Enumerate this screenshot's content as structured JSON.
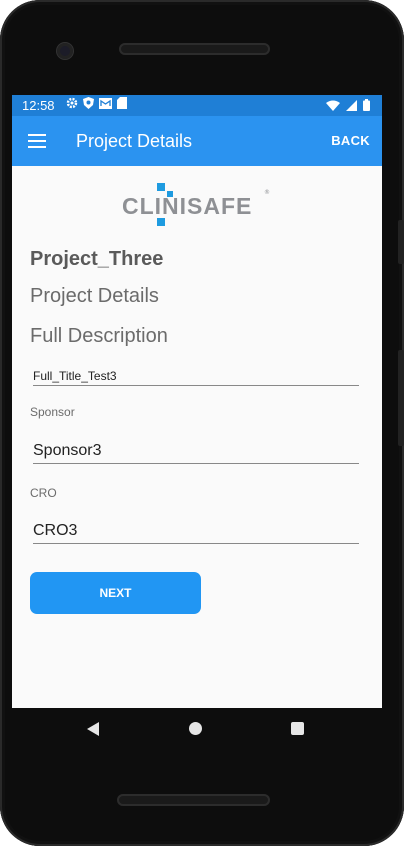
{
  "status_bar": {
    "time": "12:58",
    "left_icons": [
      "gear-icon",
      "shield-icon",
      "mail-icon",
      "sd-card-icon"
    ],
    "right_icons": [
      "wifi-icon",
      "signal-icon",
      "battery-icon"
    ]
  },
  "app_bar": {
    "title": "Project Details",
    "back_label": "BACK",
    "menu_icon": "hamburger-menu-icon"
  },
  "logo": {
    "text": "CLINISAFE",
    "reg": "®",
    "accent_color": "#1e9be0"
  },
  "project": {
    "name": "Project_Three",
    "section_title": "Project Details",
    "section_subtitle": "Full Description"
  },
  "form": {
    "full_title_value": "Full_Title_Test3",
    "sponsor_label": "Sponsor",
    "sponsor_value": "Sponsor3",
    "cro_label": "CRO",
    "cro_value": "CRO3"
  },
  "actions": {
    "next_label": "NEXT"
  },
  "colors": {
    "status_bar": "#1f7fd6",
    "app_bar": "#2b93f0",
    "primary_button": "#2196f3"
  }
}
